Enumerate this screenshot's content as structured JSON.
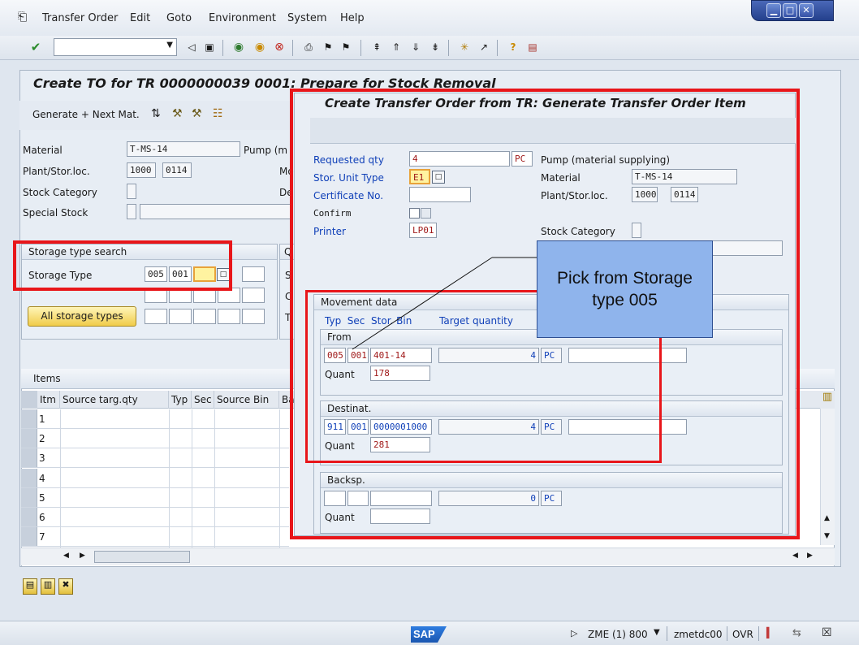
{
  "menu": {
    "items": [
      "Transfer Order",
      "Edit",
      "Goto",
      "Environment",
      "System",
      "Help"
    ]
  },
  "toolbar": {
    "command_value": ""
  },
  "main": {
    "title": "Create TO for TR 0000000039 0001: Prepare for Stock Removal",
    "app_toolbar": {
      "generate_label": "Generate + Next Mat."
    },
    "material_label": "Material",
    "material_value": "T-MS-14",
    "material_desc_partial": "Pump (m",
    "plant_label": "Plant/Stor.loc.",
    "plant_value": "1000",
    "storloc_value": "0114",
    "stock_category_label": "Stock Category",
    "special_stock_label": "Special Stock",
    "cut_labels": [
      "Mo",
      "De"
    ],
    "storage_type_search": {
      "header": "Storage type search",
      "storage_type_label": "Storage Type",
      "values": [
        "005",
        "001",
        ""
      ],
      "all_types_button": "All storage types"
    },
    "right_group_partial": {
      "header": "Q",
      "labels": [
        "S",
        "C",
        "T"
      ]
    },
    "items": {
      "header": "Items",
      "columns": [
        "Itm",
        "Source targ.qty",
        "Typ",
        "Sec",
        "Source Bin",
        "Ba"
      ],
      "rows": [
        "1",
        "2",
        "3",
        "4",
        "5",
        "6",
        "7"
      ]
    }
  },
  "dialog": {
    "title": "Create Transfer Order from TR: Generate Transfer Order Item",
    "requested_qty_label": "Requested qty",
    "requested_qty_value": "4",
    "requested_qty_unit": "PC",
    "stor_unit_type_label": "Stor. Unit Type",
    "stor_unit_type_value": "E1",
    "certificate_label": "Certificate No.",
    "confirm_label": "Confirm",
    "printer_label": "Printer",
    "printer_value": "LP01",
    "pump_desc": "Pump  (material supplying)",
    "material_label": "Material",
    "material_value": "T-MS-14",
    "plant_label": "Plant/Stor.loc.",
    "plant_value": "1000",
    "storloc_value": "0114",
    "stock_category_label": "Stock Category",
    "movement": {
      "header": "Movement data",
      "col_headers": "Typ  Sec  Stor. Bin",
      "target_qty_label": "Target quantity",
      "from": {
        "header": "From",
        "typ": "005",
        "sec": "001",
        "bin": "401-14",
        "qty": "4",
        "unit": "PC",
        "quant_label": "Quant",
        "quant": "178"
      },
      "destinat": {
        "header": "Destinat.",
        "typ": "911",
        "sec": "001",
        "bin": "0000001000",
        "qty": "4",
        "unit": "PC",
        "quant_label": "Quant",
        "quant": "281"
      },
      "backsp": {
        "header": "Backsp.",
        "typ": "",
        "sec": "",
        "bin": "",
        "qty": "0",
        "unit": "PC",
        "quant_label": "Quant",
        "quant": ""
      }
    }
  },
  "callout": {
    "line1": "Pick from Storage",
    "line2": "type 005"
  },
  "status": {
    "system": "ZME (1) 800",
    "server": "zmetdc00",
    "mode": "OVR",
    "sap_logo": "SAP"
  },
  "colors": {
    "highlight_red": "#e8161a",
    "callout_fill": "#8fb4ec",
    "label_blue": "#1040b8"
  }
}
